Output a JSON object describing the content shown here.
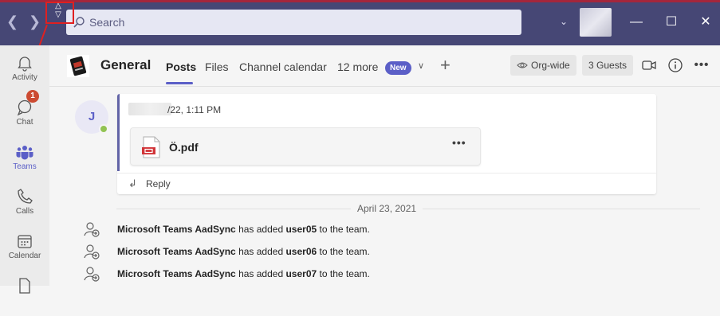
{
  "titlebar": {
    "search_placeholder": "Search"
  },
  "rail": {
    "items": [
      {
        "label": "Activity",
        "icon": "bell-icon"
      },
      {
        "label": "Chat",
        "icon": "chat-icon",
        "badge": "1"
      },
      {
        "label": "Teams",
        "icon": "teams-icon"
      },
      {
        "label": "Calls",
        "icon": "phone-icon"
      },
      {
        "label": "Calendar",
        "icon": "calendar-icon"
      }
    ]
  },
  "channel": {
    "name": "General",
    "tabs": [
      "Posts",
      "Files",
      "Channel calendar",
      "12 more"
    ],
    "new_badge": "New",
    "org_wide": "Org-wide",
    "guests": "3 Guests"
  },
  "message": {
    "avatar_initial": "J",
    "timestamp": "/22, 1:11 PM",
    "file_name": "Ö.pdf",
    "reply_label": "Reply"
  },
  "date_divider": "April 23, 2021",
  "system_messages": [
    {
      "actor": "Microsoft Teams AadSync",
      "action": "has added",
      "target": "user05",
      "suffix": "to the team."
    },
    {
      "actor": "Microsoft Teams AadSync",
      "action": "has added",
      "target": "user06",
      "suffix": "to the team."
    },
    {
      "actor": "Microsoft Teams AadSync",
      "action": "has added",
      "target": "user07",
      "suffix": "to the team."
    }
  ],
  "colors": {
    "titlebar": "#464775",
    "accent": "#5b5fc7",
    "annotation": "#e02020"
  }
}
